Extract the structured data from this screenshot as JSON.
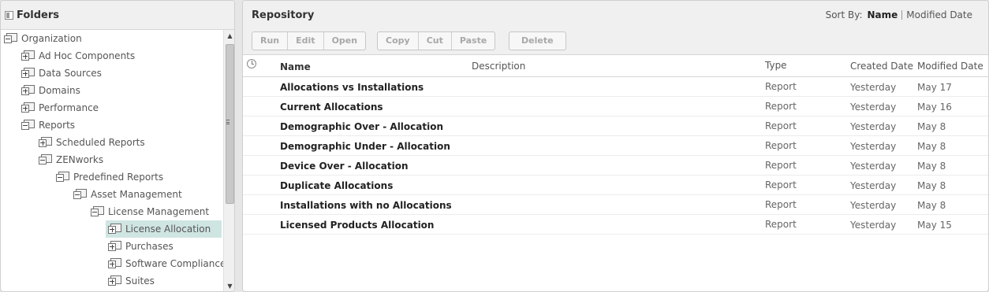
{
  "folders": {
    "title": "Folders",
    "tree": [
      {
        "label": "Organization",
        "icon": "minus"
      },
      {
        "label": "Ad Hoc Components",
        "icon": "plus"
      },
      {
        "label": "Data Sources",
        "icon": "plus"
      },
      {
        "label": "Domains",
        "icon": "plus"
      },
      {
        "label": "Performance",
        "icon": "plus"
      },
      {
        "label": "Reports",
        "icon": "minus"
      },
      {
        "label": "Scheduled Reports",
        "icon": "plus"
      },
      {
        "label": "ZENworks",
        "icon": "minus"
      },
      {
        "label": "Predefined Reports",
        "icon": "minus"
      },
      {
        "label": "Asset Management",
        "icon": "minus"
      },
      {
        "label": "License Management",
        "icon": "minus"
      },
      {
        "label": "License Allocation",
        "icon": "plus",
        "selected": true
      },
      {
        "label": "Purchases",
        "icon": "plus"
      },
      {
        "label": "Software Compliance",
        "icon": "plus"
      },
      {
        "label": "Suites",
        "icon": "plus"
      }
    ]
  },
  "repository": {
    "title": "Repository",
    "sort": {
      "label": "Sort By:",
      "active": "Name",
      "other": "Modified Date"
    },
    "toolbar": {
      "group1": [
        "Run",
        "Edit",
        "Open"
      ],
      "group2": [
        "Copy",
        "Cut",
        "Paste"
      ],
      "group3": [
        "Delete"
      ]
    },
    "columns": {
      "name": "Name",
      "description": "Description",
      "type": "Type",
      "created": "Created Date",
      "modified": "Modified Date"
    },
    "rows": [
      {
        "name": "Allocations vs Installations",
        "description": "",
        "type": "Report",
        "created": "Yesterday",
        "modified": "May 17"
      },
      {
        "name": "Current Allocations",
        "description": "",
        "type": "Report",
        "created": "Yesterday",
        "modified": "May 16"
      },
      {
        "name": "Demographic Over - Allocation",
        "description": "",
        "type": "Report",
        "created": "Yesterday",
        "modified": "May 8"
      },
      {
        "name": "Demographic Under - Allocation",
        "description": "",
        "type": "Report",
        "created": "Yesterday",
        "modified": "May 8"
      },
      {
        "name": "Device Over - Allocation",
        "description": "",
        "type": "Report",
        "created": "Yesterday",
        "modified": "May 8"
      },
      {
        "name": "Duplicate Allocations",
        "description": "",
        "type": "Report",
        "created": "Yesterday",
        "modified": "May 8"
      },
      {
        "name": "Installations with no Allocations",
        "description": "",
        "type": "Report",
        "created": "Yesterday",
        "modified": "May 8"
      },
      {
        "name": "Licensed Products Allocation",
        "description": "",
        "type": "Report",
        "created": "Yesterday",
        "modified": "May 15"
      }
    ]
  }
}
